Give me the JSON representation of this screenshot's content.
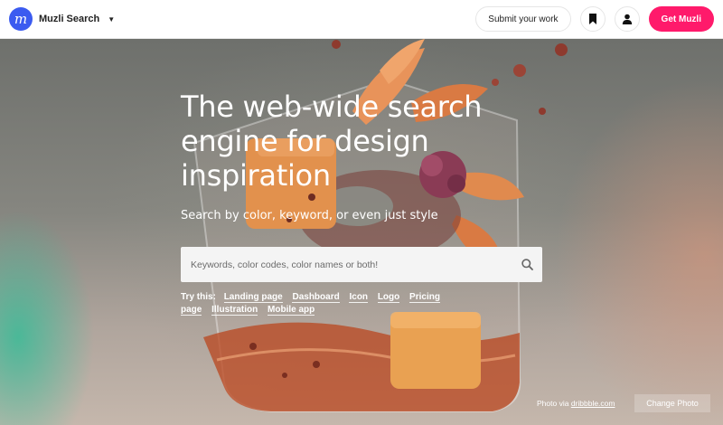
{
  "navbar": {
    "logo_letter": "m",
    "brand_name": "Muzli Search",
    "submit_label": "Submit your work",
    "cta_label": "Get Muzli"
  },
  "hero": {
    "title": "The web-wide search engine for design inspiration",
    "subtitle": "Search by color, keyword, or even just style",
    "search_placeholder": "Keywords, color codes, color names or both!",
    "try_label": "Try this:",
    "suggestions": [
      "Landing page",
      "Dashboard",
      "Icon",
      "Logo",
      "Pricing page",
      "Illustration",
      "Mobile app"
    ],
    "credit_prefix": "Photo via ",
    "credit_link": "dribbble.com",
    "change_photo_label": "Change Photo"
  },
  "colors": {
    "logo_bg": "#3b5bf0",
    "cta_bg": "#ff1a6b",
    "search_bg": "#f4f4f4"
  },
  "icons": {
    "brand_dropdown": "chevron-down-icon",
    "bookmark": "bookmark-icon",
    "user": "user-icon",
    "search": "search-icon"
  }
}
